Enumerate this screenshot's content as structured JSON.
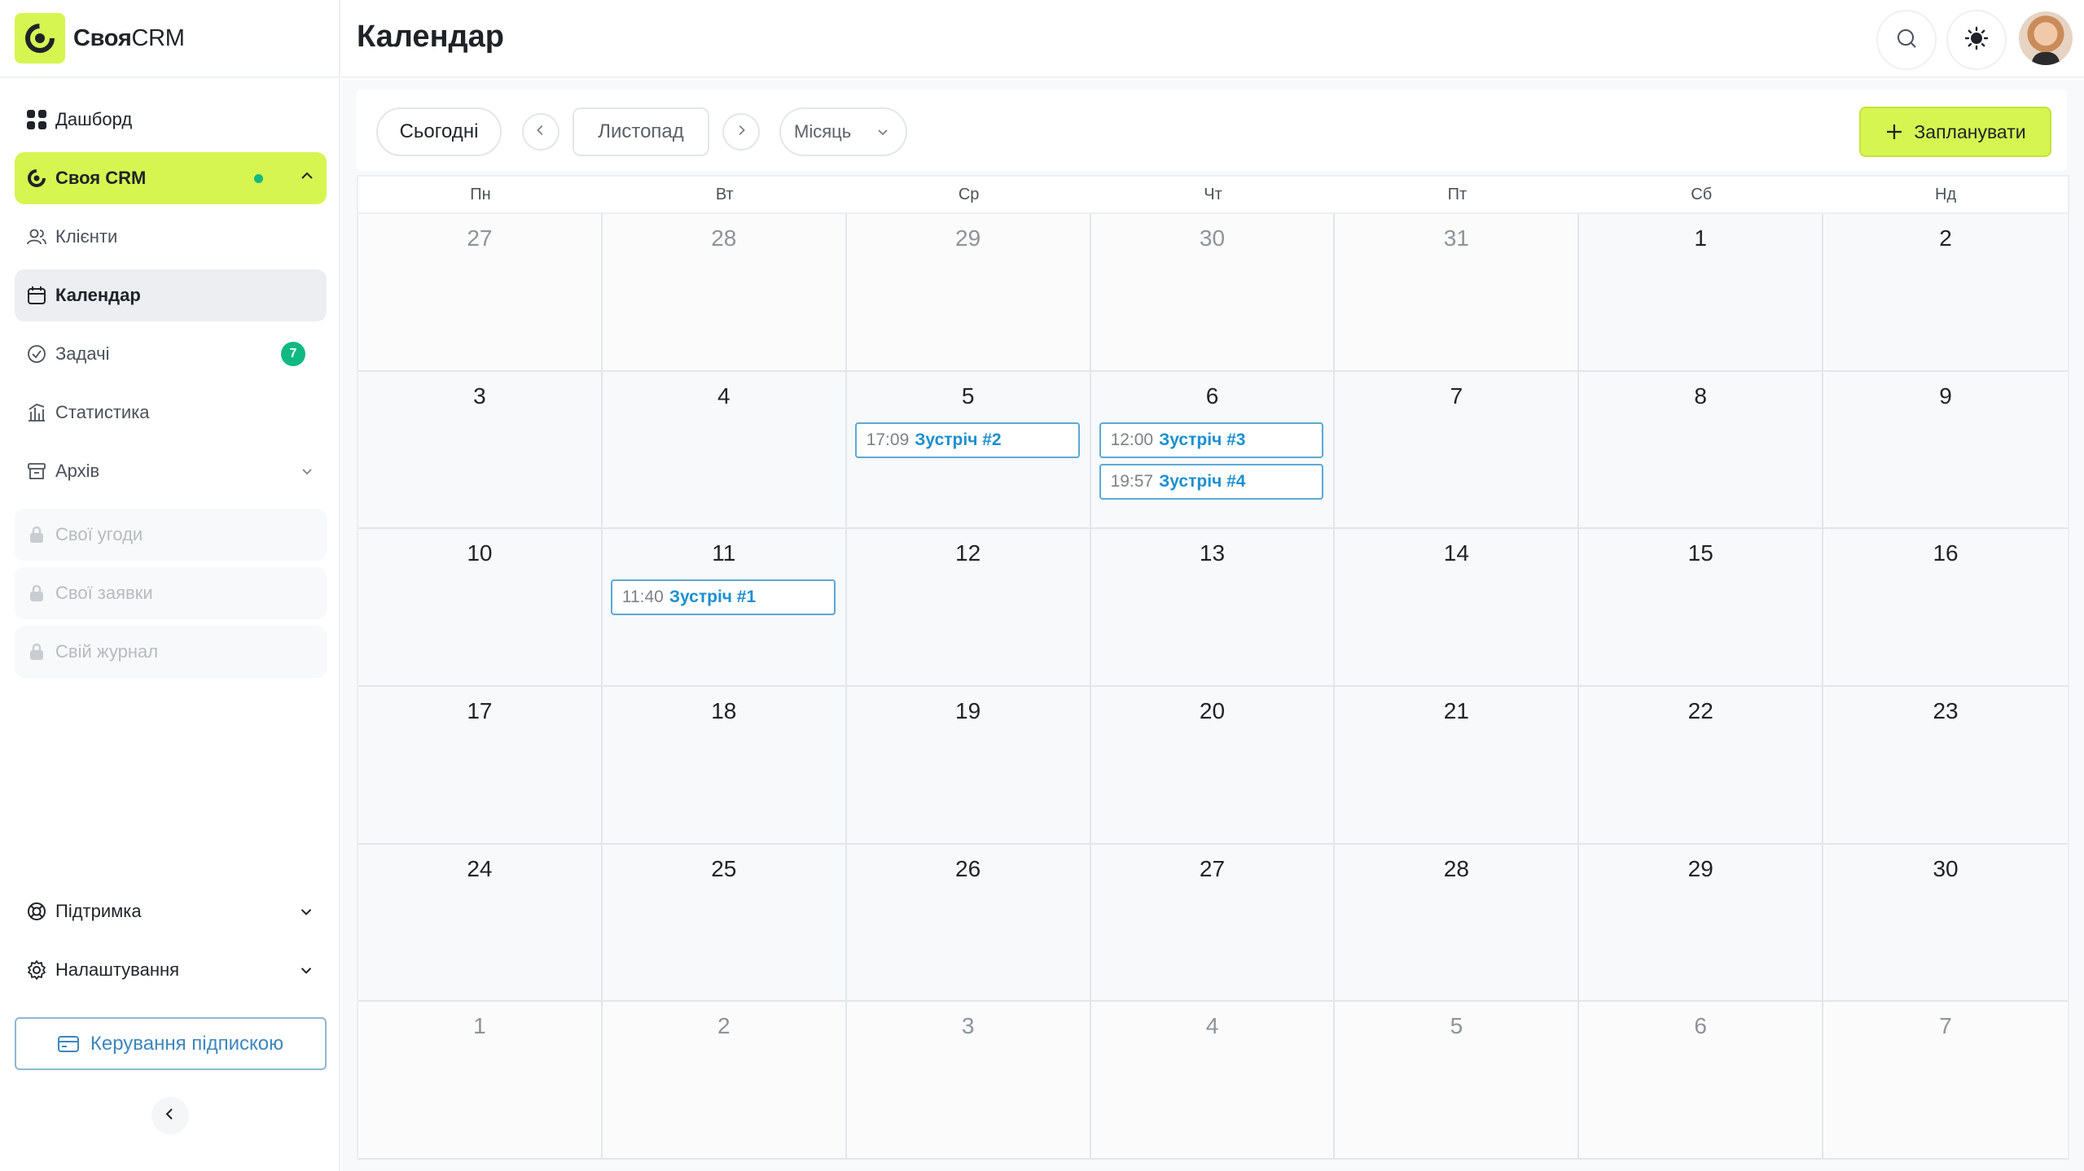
{
  "app": {
    "logo_bold": "Своя",
    "logo_light": "CRM",
    "brand_color": "#d6f551",
    "accent_green": "#10b981"
  },
  "sidebar": {
    "items": [
      {
        "label": "Дашборд",
        "icon": "grid-icon"
      },
      {
        "label": "Своя CRM",
        "icon": "logo-icon"
      },
      {
        "label": "Клієнти",
        "icon": "users-icon"
      },
      {
        "label": "Календар",
        "icon": "calendar-icon"
      },
      {
        "label": "Задачі",
        "icon": "check-circle-icon",
        "badge": "7"
      },
      {
        "label": "Статистика",
        "icon": "chart-icon"
      },
      {
        "label": "Архів",
        "icon": "archive-icon"
      },
      {
        "label": "Свої угоди",
        "icon": "lock-icon"
      },
      {
        "label": "Свої заявки",
        "icon": "lock-icon"
      },
      {
        "label": "Свій журнал",
        "icon": "lock-icon"
      },
      {
        "label": "Підтримка",
        "icon": "lifebuoy-icon"
      },
      {
        "label": "Налаштування",
        "icon": "gear-icon"
      }
    ],
    "subscription_button": "Керування підпискою"
  },
  "header": {
    "title": "Календар"
  },
  "toolbar": {
    "today": "Сьогодні",
    "month": "Листопад",
    "view": "Місяць",
    "plan": "Запланувати"
  },
  "calendar": {
    "weekdays": [
      "Пн",
      "Вт",
      "Ср",
      "Чт",
      "Пт",
      "Сб",
      "Нд"
    ],
    "weeks": [
      [
        "27",
        "28",
        "29",
        "30",
        "31",
        "1",
        "2"
      ],
      [
        "3",
        "4",
        "5",
        "6",
        "7",
        "8",
        "9"
      ],
      [
        "10",
        "11",
        "12",
        "13",
        "14",
        "15",
        "16"
      ],
      [
        "17",
        "18",
        "19",
        "20",
        "21",
        "22",
        "23"
      ],
      [
        "24",
        "25",
        "26",
        "27",
        "28",
        "29",
        "30"
      ],
      [
        "1",
        "2",
        "3",
        "4",
        "5",
        "6",
        "7"
      ]
    ],
    "events": {
      "e2": {
        "time": "17:09",
        "name": "Зустріч #2"
      },
      "e3": {
        "time": "12:00",
        "name": "Зустріч #3"
      },
      "e4": {
        "time": "19:57",
        "name": "Зустріч #4"
      },
      "e1": {
        "time": "11:40",
        "name": "Зустріч #1"
      }
    }
  }
}
